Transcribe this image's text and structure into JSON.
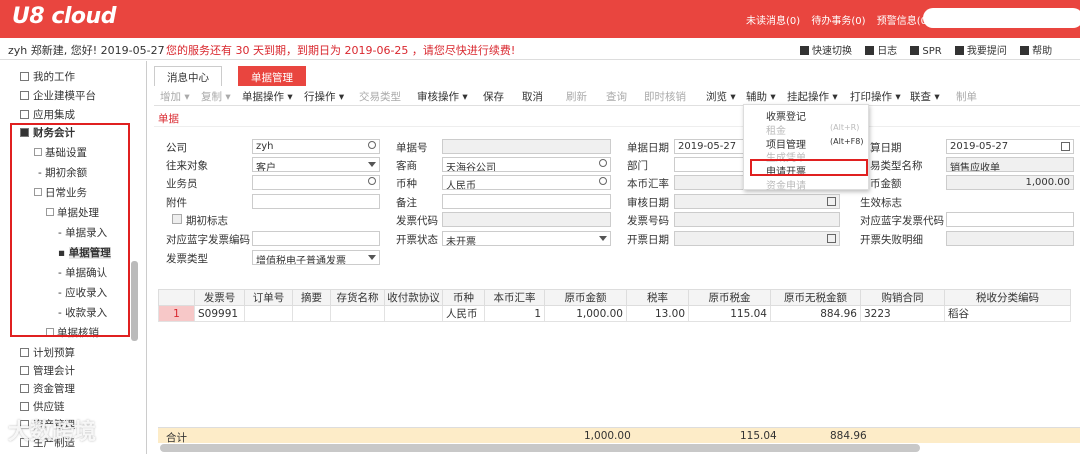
{
  "header": {
    "logo": "U8 cloud",
    "links": [
      "未读消息(0)",
      "待办事务(0)",
      "预警信息(0)"
    ]
  },
  "infobar": {
    "greeting": "zyh 郑新建, 您好! 2019-05-27",
    "warning": "您的服务还有 30 天到期，到期日为 2019-06-25 ，请您尽快进行续费!",
    "quick": [
      "快速切换",
      "日志",
      "SPR",
      "我要提问",
      "帮助"
    ]
  },
  "sidebar": {
    "top": [
      "我的工作",
      "企业建模平台",
      "应用集成",
      "财务会计"
    ],
    "tree": [
      {
        "label": "基础设置",
        "pm": "+"
      },
      {
        "label": "期初余额",
        "pm": ""
      },
      {
        "label": "日常业务",
        "pm": "-"
      },
      {
        "label": "单据处理",
        "pm": "-"
      },
      {
        "label": "单据录入",
        "pm": ""
      },
      {
        "label": "单据管理",
        "pm": ""
      },
      {
        "label": "单据确认",
        "pm": ""
      },
      {
        "label": "应收录入",
        "pm": ""
      },
      {
        "label": "收款录入",
        "pm": ""
      },
      {
        "label": "单据核销",
        "pm": "+"
      }
    ],
    "bottom": [
      "计划预算",
      "管理会计",
      "资金管理",
      "供应链",
      "资产管理",
      "生产制造"
    ]
  },
  "tabs": [
    "消息中心",
    "单据管理"
  ],
  "toolbar": [
    {
      "label": "增加 ▾",
      "dis": true
    },
    {
      "label": "复制 ▾",
      "dis": true
    },
    {
      "label": "单据操作 ▾",
      "dis": false
    },
    {
      "label": "行操作 ▾",
      "dis": false
    },
    {
      "label": "交易类型",
      "dis": true
    },
    {
      "label": "审核操作 ▾",
      "dis": false
    },
    {
      "label": "保存",
      "dis": false
    },
    {
      "label": "取消",
      "dis": false
    },
    {
      "label": "刷新",
      "dis": true
    },
    {
      "label": "查询",
      "dis": true
    },
    {
      "label": "即时核销",
      "dis": true
    },
    {
      "label": "浏览 ▾",
      "dis": false
    },
    {
      "label": "辅助 ▾",
      "dis": false
    },
    {
      "label": "挂起操作 ▾",
      "dis": false
    },
    {
      "label": "打印操作 ▾",
      "dis": false
    },
    {
      "label": "联查 ▾",
      "dis": false
    },
    {
      "label": "制单",
      "dis": true
    }
  ],
  "section": "单据",
  "form": {
    "labels": [
      "公司",
      "往来对象",
      "业务员",
      "附件",
      "期初标志",
      "对应蓝字发票编码",
      "发票类型",
      "单据号",
      "客商",
      "币种",
      "备注",
      "发票代码",
      "开票状态",
      "单据日期",
      "部门",
      "本币汇率",
      "审核日期",
      "发票号码",
      "开票日期",
      "算日期",
      "易类型名称",
      "币金额",
      "生效标志",
      "对应蓝字发票代码",
      "开票失败明细"
    ],
    "values": {
      "company": "zyh",
      "party": "客户",
      "merchant": "天海谷公司",
      "currency": "人民币",
      "invoice_status": "未开票",
      "invoice_type": "增值税电子普通发票",
      "doc_date": "2019-05-27",
      "calc_date": "2019-05-27",
      "trans_type": "销售应收单",
      "amount": "1,000.00"
    }
  },
  "menu": {
    "items": [
      {
        "label": "收票登记",
        "dis": false
      },
      {
        "label": "租金",
        "dis": true
      },
      {
        "label": "项目管理",
        "dis": false
      },
      {
        "label": "生成凭单",
        "dis": true
      },
      {
        "label": "申请开票",
        "dis": false
      },
      {
        "label": "资金申请",
        "dis": true
      }
    ],
    "shortcuts": [
      "(Alt+R)",
      "(Alt+F8)"
    ]
  },
  "grid": {
    "headers": [
      "",
      "发票号",
      "订单号",
      "摘要",
      "存货名称",
      "收付款协议",
      "币种",
      "本币汇率",
      "原币金额",
      "税率",
      "原币税金",
      "原币无税金额",
      "购销合同",
      "税收分类编码"
    ],
    "rows": [
      [
        "1",
        "S09991",
        "",
        "",
        "",
        "",
        "人民币",
        "1",
        "1,000.00",
        "13.00",
        "115.04",
        "884.96",
        "3223",
        "稻谷"
      ]
    ],
    "sum_label": "合计",
    "sum": {
      "amount": "1,000.00",
      "tax": "115.04",
      "notax": "884.96"
    }
  },
  "watermark": "大数跨境"
}
